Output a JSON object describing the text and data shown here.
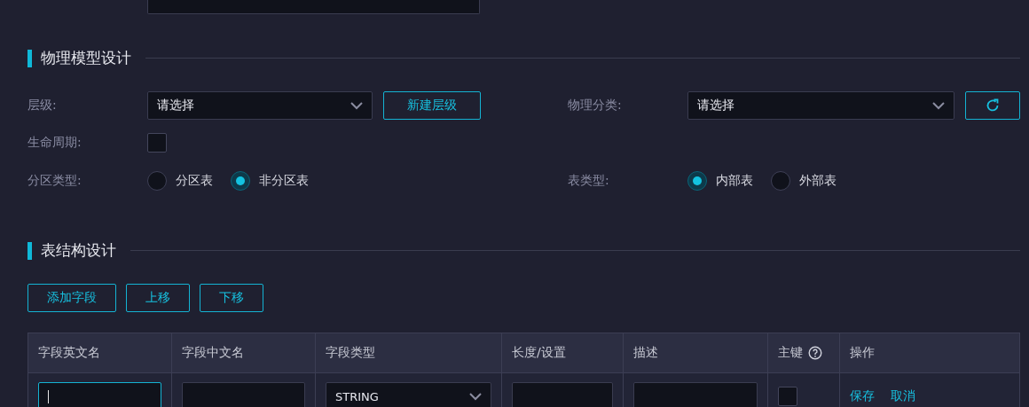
{
  "physical_model": {
    "title": "物理模型设计",
    "level": {
      "label": "层级:",
      "placeholder": "请选择",
      "button": "新建层级"
    },
    "category": {
      "label": "物理分类:",
      "placeholder": "请选择"
    },
    "lifecycle": {
      "label": "生命周期:",
      "checked": false
    },
    "partition_type": {
      "label": "分区类型:",
      "options": [
        {
          "label": "分区表",
          "selected": false
        },
        {
          "label": "非分区表",
          "selected": true
        }
      ]
    },
    "table_type": {
      "label": "表类型:",
      "options": [
        {
          "label": "内部表",
          "selected": true
        },
        {
          "label": "外部表",
          "selected": false
        }
      ]
    }
  },
  "table_design": {
    "title": "表结构设计",
    "buttons": [
      "添加字段",
      "上移",
      "下移"
    ],
    "table": {
      "columns": [
        {
          "label": "字段英文名",
          "help": false
        },
        {
          "label": "字段中文名",
          "help": false
        },
        {
          "label": "字段类型",
          "help": false
        },
        {
          "label": "长度/设置",
          "help": false
        },
        {
          "label": "描述",
          "help": false
        },
        {
          "label": "主键",
          "help": true
        },
        {
          "label": "操作",
          "help": false
        }
      ],
      "rows": [
        {
          "cells": [
            {
              "kind": "input",
              "focused": true
            },
            {
              "kind": "input",
              "focused": false
            },
            {
              "kind": "select",
              "value": "STRING"
            },
            {
              "kind": "input",
              "focused": false
            },
            {
              "kind": "input",
              "focused": false
            },
            {
              "kind": "checkbox",
              "checked": false
            },
            {
              "kind": "actions",
              "links": [
                "保存",
                "取消"
              ]
            }
          ]
        }
      ]
    }
  }
}
